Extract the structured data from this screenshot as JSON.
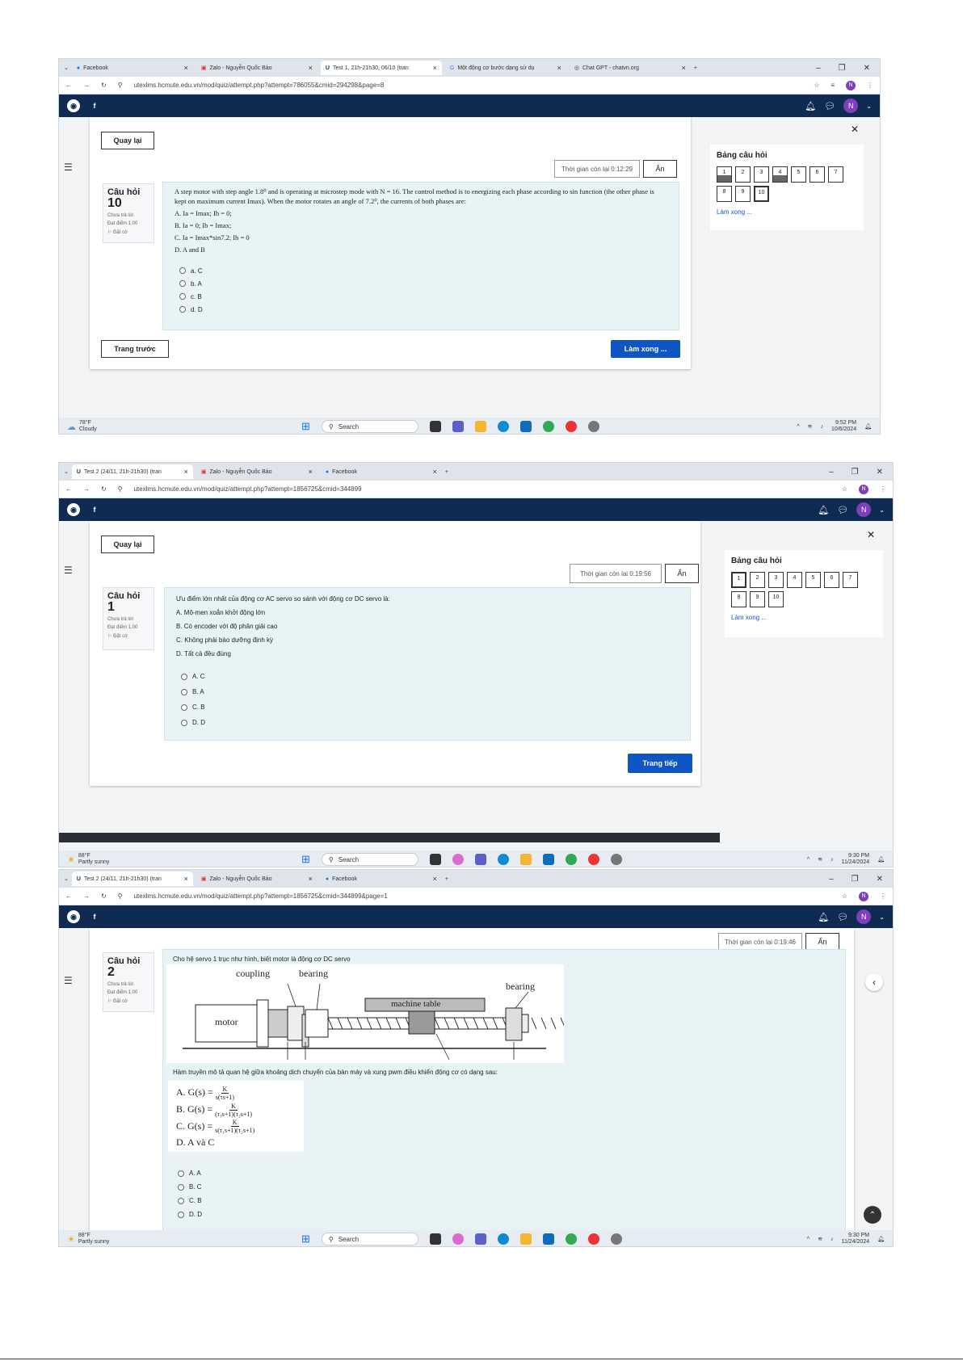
{
  "shot1": {
    "tabs": [
      {
        "icon": "facebook-icon",
        "label": "Facebook"
      },
      {
        "icon": "zalo-icon",
        "label": "Zalo - Nguyễn Quốc Bảo"
      },
      {
        "icon": "ute-icon",
        "label": "Test 1, 21h-21h30, 06/10 (tran"
      },
      {
        "icon": "google-icon",
        "label": "Một động cơ bước dạng sử dụ"
      },
      {
        "icon": "chatgpt-icon",
        "label": "Chat GPT - chatvn.org"
      }
    ],
    "url": "utexlms.hcmute.edu.vn/mod/quiz/attempt.php?attempt=786055&cmid=294298&page=8",
    "back": "Quay lại",
    "timer": "Thời gian còn lại 0:12:29",
    "hide": "Ẩn",
    "q_label": "Câu hỏi",
    "q_num": "10",
    "q_status": "Chưa trả lời",
    "q_score": "Đạt điểm 1,00",
    "q_flag": "Đặt cờ",
    "q_text": "A step motor with step angle 1.8⁰ and is operating at microstep mode with N = 16. The control method is to energizing each phase according to sin function (the other phase is kept on maximum current Imax). When the motor rotates an angle of 7.2⁰, the currents of both phases are:",
    "choices": [
      "A.   Ia = Imax; Ib = 0;",
      "B.   Ia = 0; Ib = Imax;",
      "C.   Ia = Imax*sin7.2; Ib = 0",
      "D.   A and B"
    ],
    "options": [
      "a.  C",
      "b.  A",
      "c.  B",
      "d.  D"
    ],
    "prev": "Trang trước",
    "finish": "Làm xong ...",
    "nav_title": "Bảng câu hỏi",
    "nav_nums": [
      "1",
      "2",
      "3",
      "4",
      "5",
      "6",
      "7",
      "8",
      "9",
      "10"
    ],
    "nav_finish": "Làm xong ...",
    "weather_temp": "78°F",
    "weather_desc": "Cloudy",
    "search": "Search",
    "time": "9:52 PM",
    "date": "10/6/2024"
  },
  "shot2": {
    "tabs": [
      {
        "icon": "ute-icon",
        "label": "Test 2 (24/11, 21h-21h30) (tran"
      },
      {
        "icon": "zalo-icon",
        "label": "Zalo - Nguyễn Quốc Bảo"
      },
      {
        "icon": "facebook-icon",
        "label": "Facebook"
      }
    ],
    "url": "utexlms.hcmute.edu.vn/mod/quiz/attempt.php?attempt=1856725&cmid=344899",
    "back": "Quay lại",
    "timer": "Thời gian còn lại 0:19:56",
    "hide": "Ẩn",
    "q_label": "Câu hỏi",
    "q_num": "1",
    "q_status": "Chưa trả lời",
    "q_score": "Đạt điểm 1,00",
    "q_flag": "Đặt cờ",
    "q_text": "Ưu điểm lớn nhất của động cơ AC servo so sánh với động cơ DC servo là:",
    "choices": [
      "A.   Mô-men xoắn khởi động lớn",
      "B.   Có encoder với độ phân giải cao",
      "C.   Không phải bảo dưỡng định kỳ",
      "D.   Tất cả đều đúng"
    ],
    "options": [
      "A.  C",
      "B.  A",
      "C.  B",
      "D.  D"
    ],
    "next": "Trang tiếp",
    "nav_title": "Bảng câu hỏi",
    "nav_nums": [
      "1",
      "2",
      "3",
      "4",
      "5",
      "6",
      "7",
      "8",
      "9",
      "10"
    ],
    "nav_finish": "Làm xong ...",
    "weather_temp": "88°F",
    "weather_desc": "Partly sunny",
    "search": "Search",
    "time": "9:30 PM",
    "date": "11/24/2024"
  },
  "shot3": {
    "tabs": [
      {
        "icon": "ute-icon",
        "label": "Test 2 (24/11, 21h-21h30) (tran"
      },
      {
        "icon": "zalo-icon",
        "label": "Zalo - Nguyễn Quốc Bảo"
      },
      {
        "icon": "facebook-icon",
        "label": "Facebook"
      }
    ],
    "url": "utexlms.hcmute.edu.vn/mod/quiz/attempt.php?attempt=1856725&cmid=344899&page=1",
    "timer": "Thời gian còn lại 0:19:46",
    "hide": "Ẩn",
    "q_label": "Câu hỏi",
    "q_num": "2",
    "q_status": "Chưa trả lời",
    "q_score": "Đạt điểm 1,00",
    "q_flag": "Đặt cờ",
    "q_intro": "Cho hệ servo 1 trục như hình, biết motor là động cơ DC servo",
    "diagram_labels": {
      "coupling": "coupling",
      "bearing1": "bearing",
      "bearing2": "bearing",
      "table": "machine table",
      "motor": "motor"
    },
    "q_text2": "Hàm truyền mô tả quan hệ giữa khoảng dịch chuyển của bàn máy và xung pwm điều khiển động cơ có dạng sau:",
    "formulas": {
      "a_pre": "A.  G(s) =",
      "a_num": "K",
      "a_den": "s(τs+1)",
      "b_pre": "B.  G(s) =",
      "b_num": "K",
      "b_den": "(τ₁s+1)(τ₂s+1)",
      "c_pre": "C.  G(s) =",
      "c_num": "K",
      "c_den": "s(τ₁s+1)(τ₂s+1)",
      "d": "D.  A và C"
    },
    "options": [
      "A.  A",
      "B.  C",
      "C.  B",
      "D.  D"
    ],
    "weather_temp": "88°F",
    "weather_desc": "Partly sunny",
    "search": "Search",
    "time": "9:30 PM",
    "date": "11/24/2024"
  },
  "colors": {
    "navbar": "#0f2b52",
    "primary": "#0f55c4",
    "question_bg": "#e7f3f5",
    "avatar": "#7e3fb8"
  }
}
